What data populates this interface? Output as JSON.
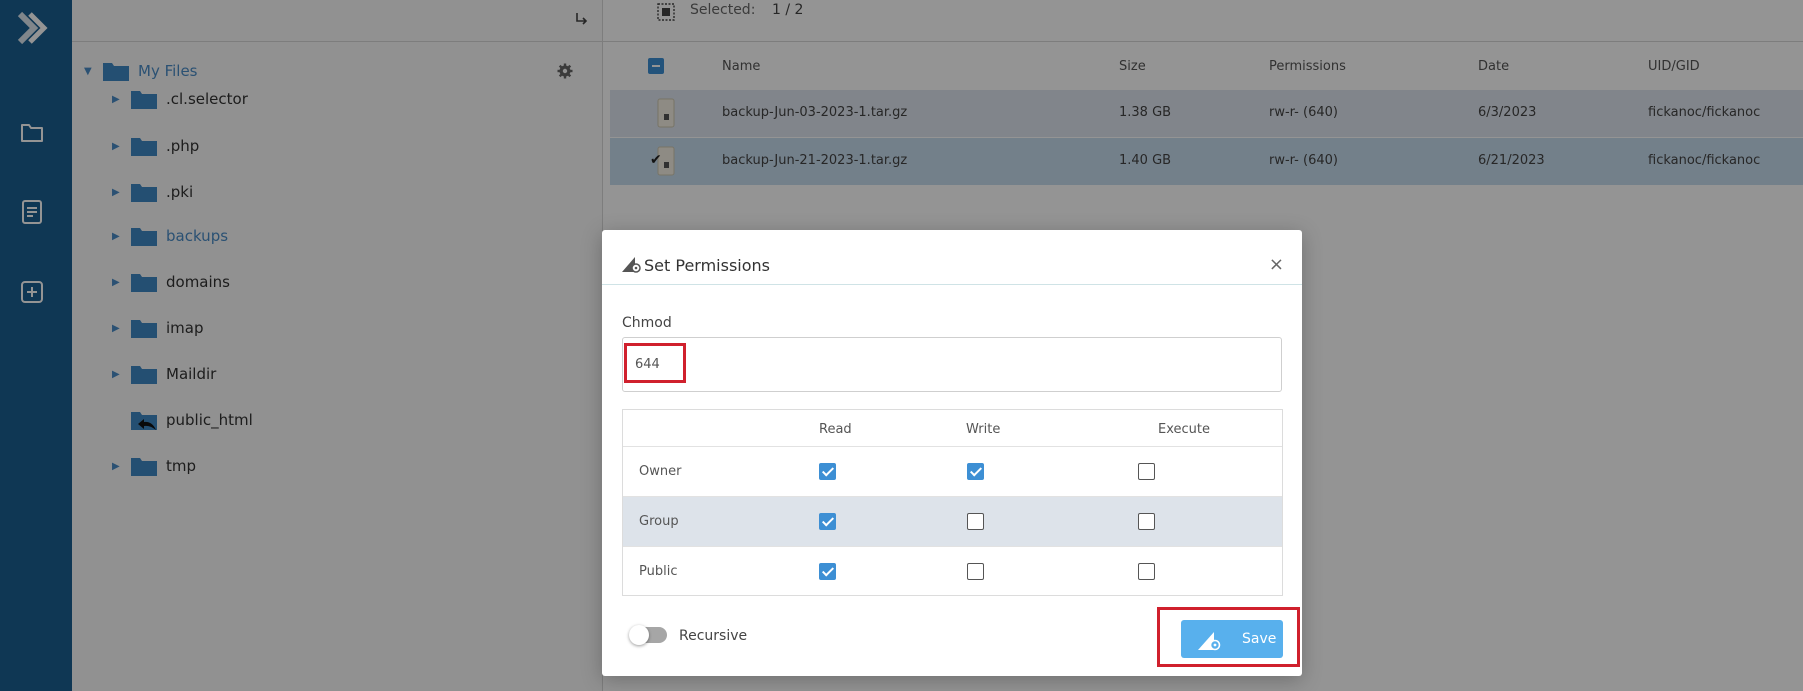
{
  "toolbar": {
    "selected_label": "Selected:",
    "selected_count": "1 / 2"
  },
  "tree": {
    "root": {
      "label": "My Files"
    },
    "items": [
      {
        "label": ".cl.selector",
        "icon": "folder-icon"
      },
      {
        "label": ".php",
        "icon": "folder-icon"
      },
      {
        "label": ".pki",
        "icon": "folder-icon"
      },
      {
        "label": "backups",
        "icon": "folder-icon",
        "active": true
      },
      {
        "label": "domains",
        "icon": "folder-icon"
      },
      {
        "label": "imap",
        "icon": "folder-icon"
      },
      {
        "label": "Maildir",
        "icon": "folder-icon"
      },
      {
        "label": "public_html",
        "icon": "folder-link-icon"
      },
      {
        "label": "tmp",
        "icon": "folder-icon"
      }
    ]
  },
  "table": {
    "columns": [
      "Name",
      "Size",
      "Permissions",
      "Date",
      "UID/GID"
    ],
    "rows": [
      {
        "name": "backup-Jun-03-2023-1.tar.gz",
        "size": "1.38 GB",
        "permissions": "rw-r- (640)",
        "date": "6/3/2023",
        "uid": "fickanoc/fickanoc",
        "selected": false
      },
      {
        "name": "backup-Jun-21-2023-1.tar.gz",
        "size": "1.40 GB",
        "permissions": "rw-r- (640)",
        "date": "6/21/2023",
        "uid": "fickanoc/fickanoc",
        "selected": true
      }
    ]
  },
  "modal": {
    "title": "Set Permissions",
    "close": "×",
    "chmod_label": "Chmod",
    "chmod_value": "644",
    "perm_columns": [
      "Read",
      "Write",
      "Execute"
    ],
    "perm_rows": [
      {
        "label": "Owner",
        "read": true,
        "write": true,
        "execute": false
      },
      {
        "label": "Group",
        "read": true,
        "write": false,
        "execute": false
      },
      {
        "label": "Public",
        "read": true,
        "write": false,
        "execute": false
      }
    ],
    "recursive_label": "Recursive",
    "recursive_on": false,
    "save_label": "Save"
  },
  "colors": {
    "rail": "#1b5f91",
    "accent": "#3d8fd4",
    "highlight": "#d0202d",
    "save": "#58b0ed"
  }
}
